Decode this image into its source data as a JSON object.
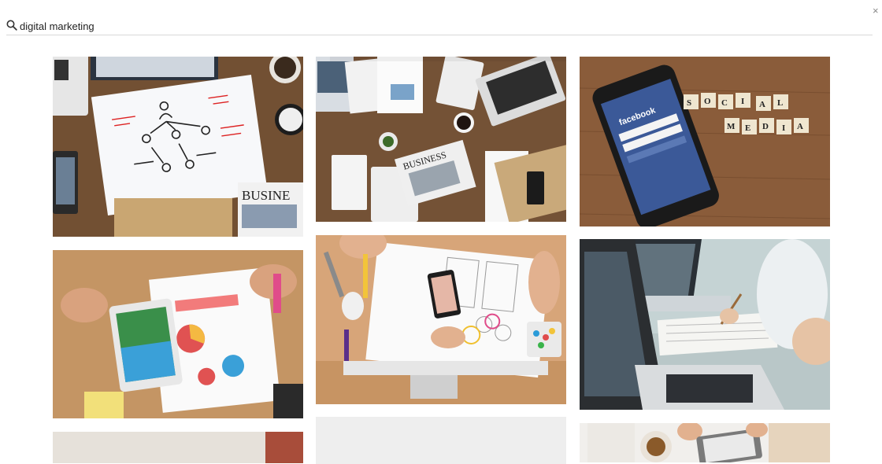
{
  "search": {
    "icon": "search-icon",
    "value": "digital marketing",
    "placeholder": ""
  },
  "close": {
    "icon": "close-icon",
    "label": "×"
  },
  "results": [
    {
      "id": "r1",
      "subject": "workflow-diagram-desk"
    },
    {
      "id": "r2",
      "subject": "business-desk-newspaper"
    },
    {
      "id": "r3",
      "subject": "facebook-phone-social-media-tiles"
    },
    {
      "id": "r4",
      "subject": "tablet-charts-desk"
    },
    {
      "id": "r5",
      "subject": "smartphone-sketches-desk"
    },
    {
      "id": "r6",
      "subject": "laptop-meeting-notes"
    },
    {
      "id": "r7",
      "subject": "partial-photo"
    },
    {
      "id": "r8",
      "subject": "partial-photo"
    },
    {
      "id": "r9",
      "subject": "coffee-tablet-desk"
    }
  ],
  "tile_texts": {
    "newspaper_1": "BUSINE",
    "newspaper_2": "BUSINESS",
    "facebook": "facebook",
    "social": [
      "S",
      "O",
      "C",
      "I",
      "A",
      "L"
    ],
    "media": [
      "M",
      "E",
      "D",
      "I",
      "A"
    ]
  }
}
